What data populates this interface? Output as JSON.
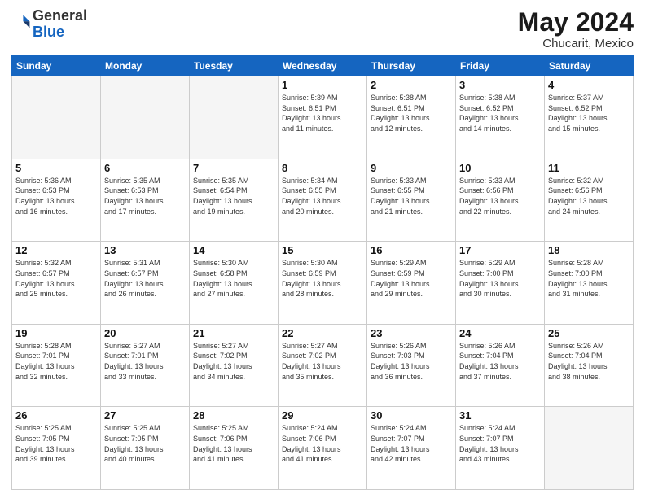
{
  "header": {
    "logo_general": "General",
    "logo_blue": "Blue",
    "month_year": "May 2024",
    "location": "Chucarit, Mexico"
  },
  "days_of_week": [
    "Sunday",
    "Monday",
    "Tuesday",
    "Wednesday",
    "Thursday",
    "Friday",
    "Saturday"
  ],
  "weeks": [
    [
      {
        "day": "",
        "info": ""
      },
      {
        "day": "",
        "info": ""
      },
      {
        "day": "",
        "info": ""
      },
      {
        "day": "1",
        "info": "Sunrise: 5:39 AM\nSunset: 6:51 PM\nDaylight: 13 hours\nand 11 minutes."
      },
      {
        "day": "2",
        "info": "Sunrise: 5:38 AM\nSunset: 6:51 PM\nDaylight: 13 hours\nand 12 minutes."
      },
      {
        "day": "3",
        "info": "Sunrise: 5:38 AM\nSunset: 6:52 PM\nDaylight: 13 hours\nand 14 minutes."
      },
      {
        "day": "4",
        "info": "Sunrise: 5:37 AM\nSunset: 6:52 PM\nDaylight: 13 hours\nand 15 minutes."
      }
    ],
    [
      {
        "day": "5",
        "info": "Sunrise: 5:36 AM\nSunset: 6:53 PM\nDaylight: 13 hours\nand 16 minutes."
      },
      {
        "day": "6",
        "info": "Sunrise: 5:35 AM\nSunset: 6:53 PM\nDaylight: 13 hours\nand 17 minutes."
      },
      {
        "day": "7",
        "info": "Sunrise: 5:35 AM\nSunset: 6:54 PM\nDaylight: 13 hours\nand 19 minutes."
      },
      {
        "day": "8",
        "info": "Sunrise: 5:34 AM\nSunset: 6:55 PM\nDaylight: 13 hours\nand 20 minutes."
      },
      {
        "day": "9",
        "info": "Sunrise: 5:33 AM\nSunset: 6:55 PM\nDaylight: 13 hours\nand 21 minutes."
      },
      {
        "day": "10",
        "info": "Sunrise: 5:33 AM\nSunset: 6:56 PM\nDaylight: 13 hours\nand 22 minutes."
      },
      {
        "day": "11",
        "info": "Sunrise: 5:32 AM\nSunset: 6:56 PM\nDaylight: 13 hours\nand 24 minutes."
      }
    ],
    [
      {
        "day": "12",
        "info": "Sunrise: 5:32 AM\nSunset: 6:57 PM\nDaylight: 13 hours\nand 25 minutes."
      },
      {
        "day": "13",
        "info": "Sunrise: 5:31 AM\nSunset: 6:57 PM\nDaylight: 13 hours\nand 26 minutes."
      },
      {
        "day": "14",
        "info": "Sunrise: 5:30 AM\nSunset: 6:58 PM\nDaylight: 13 hours\nand 27 minutes."
      },
      {
        "day": "15",
        "info": "Sunrise: 5:30 AM\nSunset: 6:59 PM\nDaylight: 13 hours\nand 28 minutes."
      },
      {
        "day": "16",
        "info": "Sunrise: 5:29 AM\nSunset: 6:59 PM\nDaylight: 13 hours\nand 29 minutes."
      },
      {
        "day": "17",
        "info": "Sunrise: 5:29 AM\nSunset: 7:00 PM\nDaylight: 13 hours\nand 30 minutes."
      },
      {
        "day": "18",
        "info": "Sunrise: 5:28 AM\nSunset: 7:00 PM\nDaylight: 13 hours\nand 31 minutes."
      }
    ],
    [
      {
        "day": "19",
        "info": "Sunrise: 5:28 AM\nSunset: 7:01 PM\nDaylight: 13 hours\nand 32 minutes."
      },
      {
        "day": "20",
        "info": "Sunrise: 5:27 AM\nSunset: 7:01 PM\nDaylight: 13 hours\nand 33 minutes."
      },
      {
        "day": "21",
        "info": "Sunrise: 5:27 AM\nSunset: 7:02 PM\nDaylight: 13 hours\nand 34 minutes."
      },
      {
        "day": "22",
        "info": "Sunrise: 5:27 AM\nSunset: 7:02 PM\nDaylight: 13 hours\nand 35 minutes."
      },
      {
        "day": "23",
        "info": "Sunrise: 5:26 AM\nSunset: 7:03 PM\nDaylight: 13 hours\nand 36 minutes."
      },
      {
        "day": "24",
        "info": "Sunrise: 5:26 AM\nSunset: 7:04 PM\nDaylight: 13 hours\nand 37 minutes."
      },
      {
        "day": "25",
        "info": "Sunrise: 5:26 AM\nSunset: 7:04 PM\nDaylight: 13 hours\nand 38 minutes."
      }
    ],
    [
      {
        "day": "26",
        "info": "Sunrise: 5:25 AM\nSunset: 7:05 PM\nDaylight: 13 hours\nand 39 minutes."
      },
      {
        "day": "27",
        "info": "Sunrise: 5:25 AM\nSunset: 7:05 PM\nDaylight: 13 hours\nand 40 minutes."
      },
      {
        "day": "28",
        "info": "Sunrise: 5:25 AM\nSunset: 7:06 PM\nDaylight: 13 hours\nand 41 minutes."
      },
      {
        "day": "29",
        "info": "Sunrise: 5:24 AM\nSunset: 7:06 PM\nDaylight: 13 hours\nand 41 minutes."
      },
      {
        "day": "30",
        "info": "Sunrise: 5:24 AM\nSunset: 7:07 PM\nDaylight: 13 hours\nand 42 minutes."
      },
      {
        "day": "31",
        "info": "Sunrise: 5:24 AM\nSunset: 7:07 PM\nDaylight: 13 hours\nand 43 minutes."
      },
      {
        "day": "",
        "info": ""
      }
    ]
  ]
}
